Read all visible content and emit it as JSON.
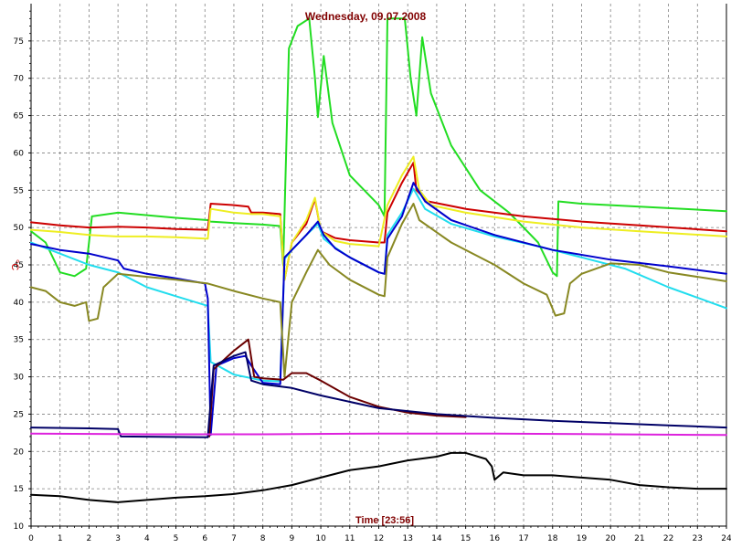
{
  "chart_data": {
    "type": "line",
    "title": "Wednesday, 09.07.2008",
    "xlabel": "Time [23:56]",
    "ylabel": "°C",
    "xlim": [
      0,
      24
    ],
    "ylim": [
      10,
      80
    ],
    "grid": true,
    "x_ticks": [
      "0",
      "1",
      "2",
      "3",
      "4",
      "5",
      "6",
      "7",
      "8",
      "9",
      "10",
      "11",
      "12",
      "13",
      "14",
      "15",
      "16",
      "17",
      "18",
      "19",
      "20",
      "21",
      "22",
      "23",
      "24"
    ],
    "y_ticks": [
      "10",
      "15",
      "20",
      "25",
      "30",
      "35",
      "40",
      "45",
      "50",
      "55",
      "60",
      "65",
      "70",
      "75"
    ],
    "series": [
      {
        "color": "#22dd22",
        "points": [
          [
            0,
            49.5
          ],
          [
            0.5,
            48
          ],
          [
            1,
            44
          ],
          [
            1.5,
            43.5
          ],
          [
            1.9,
            44.5
          ],
          [
            2.1,
            51.5
          ],
          [
            3,
            52
          ],
          [
            5,
            51.3
          ],
          [
            6.1,
            51
          ],
          [
            6.2,
            50.8
          ],
          [
            7,
            50.6
          ],
          [
            8,
            50.4
          ],
          [
            8.6,
            50.2
          ],
          [
            8.7,
            45
          ],
          [
            8.9,
            74
          ],
          [
            9.2,
            77
          ],
          [
            9.6,
            78
          ],
          [
            9.8,
            70
          ],
          [
            9.9,
            64.8
          ],
          [
            10.1,
            73
          ],
          [
            10.4,
            64
          ],
          [
            11,
            57
          ],
          [
            12,
            53
          ],
          [
            12.2,
            51.5
          ],
          [
            12.3,
            78
          ],
          [
            12.9,
            78
          ],
          [
            13.1,
            70
          ],
          [
            13.3,
            65
          ],
          [
            13.5,
            75.5
          ],
          [
            13.8,
            68
          ],
          [
            14.5,
            61
          ],
          [
            15.5,
            55
          ],
          [
            16.5,
            52
          ],
          [
            17.5,
            48
          ],
          [
            18,
            44
          ],
          [
            18.15,
            43.5
          ],
          [
            18.2,
            53.5
          ],
          [
            19,
            53.2
          ],
          [
            20,
            53
          ],
          [
            22,
            52.6
          ],
          [
            24,
            52.2
          ]
        ]
      },
      {
        "color": "#cc0000",
        "points": [
          [
            0,
            50.7
          ],
          [
            1,
            50.3
          ],
          [
            2,
            50
          ],
          [
            3,
            50.1
          ],
          [
            4,
            50
          ],
          [
            5,
            49.8
          ],
          [
            6.1,
            49.7
          ],
          [
            6.2,
            53.2
          ],
          [
            7,
            53
          ],
          [
            7.5,
            52.8
          ],
          [
            7.6,
            52
          ],
          [
            8,
            52
          ],
          [
            8.6,
            51.8
          ],
          [
            8.75,
            43
          ],
          [
            9,
            48
          ],
          [
            9.5,
            50.5
          ],
          [
            9.8,
            53.8
          ],
          [
            10,
            49.5
          ],
          [
            10.5,
            48.6
          ],
          [
            11,
            48.3
          ],
          [
            12,
            48
          ],
          [
            12.2,
            48
          ],
          [
            12.3,
            52
          ],
          [
            12.8,
            56
          ],
          [
            13.2,
            58.7
          ],
          [
            13.3,
            55
          ],
          [
            13.7,
            53.5
          ],
          [
            15,
            52.5
          ],
          [
            17,
            51.5
          ],
          [
            19,
            50.8
          ],
          [
            21,
            50.3
          ],
          [
            24,
            49.5
          ]
        ]
      },
      {
        "color": "#eeee22",
        "points": [
          [
            0,
            49.7
          ],
          [
            1,
            49.4
          ],
          [
            2,
            49
          ],
          [
            3,
            48.8
          ],
          [
            4,
            48.8
          ],
          [
            5,
            48.7
          ],
          [
            6.1,
            48.5
          ],
          [
            6.2,
            52.5
          ],
          [
            7,
            52
          ],
          [
            7.6,
            51.8
          ],
          [
            8,
            51.8
          ],
          [
            8.6,
            51.5
          ],
          [
            8.75,
            43
          ],
          [
            9,
            48
          ],
          [
            9.5,
            51
          ],
          [
            9.8,
            54
          ],
          [
            10,
            49.5
          ],
          [
            10.5,
            48.2
          ],
          [
            11,
            47.8
          ],
          [
            12,
            47.5
          ],
          [
            12.3,
            53
          ],
          [
            12.8,
            57
          ],
          [
            13.2,
            59.5
          ],
          [
            13.4,
            55
          ],
          [
            13.8,
            53
          ],
          [
            15,
            52
          ],
          [
            17,
            50.8
          ],
          [
            19,
            50
          ],
          [
            21,
            49.5
          ],
          [
            24,
            48.8
          ]
        ]
      },
      {
        "color": "#22ddee",
        "points": [
          [
            0,
            48
          ],
          [
            1,
            46.5
          ],
          [
            2,
            45
          ],
          [
            3,
            44
          ],
          [
            4,
            42
          ],
          [
            5,
            40.8
          ],
          [
            6.1,
            39.5
          ],
          [
            6.2,
            32
          ],
          [
            7,
            30.3
          ],
          [
            8,
            29.5
          ],
          [
            8.6,
            29.4
          ],
          [
            8.75,
            45.8
          ],
          [
            9,
            47
          ],
          [
            9.5,
            49
          ],
          [
            9.9,
            50.5
          ],
          [
            10.1,
            48.5
          ],
          [
            10.5,
            47.3
          ],
          [
            11,
            46
          ],
          [
            12,
            44
          ],
          [
            12.2,
            43.8
          ],
          [
            12.3,
            49
          ],
          [
            12.8,
            52
          ],
          [
            13.2,
            55.2
          ],
          [
            13.6,
            52.5
          ],
          [
            14.5,
            50.5
          ],
          [
            16,
            48.8
          ],
          [
            17.5,
            47.5
          ],
          [
            19,
            46
          ],
          [
            20.5,
            44.5
          ],
          [
            22,
            42
          ],
          [
            24,
            39.2
          ]
        ]
      },
      {
        "color": "#0000cc",
        "points": [
          [
            0,
            47.8
          ],
          [
            1,
            47
          ],
          [
            2,
            46.5
          ],
          [
            3,
            45.6
          ],
          [
            3.2,
            44.5
          ],
          [
            4,
            43.8
          ],
          [
            5,
            43.2
          ],
          [
            6,
            42.5
          ],
          [
            6.1,
            40.5
          ],
          [
            6.2,
            22.2
          ],
          [
            6.4,
            31.5
          ],
          [
            7,
            32.5
          ],
          [
            7.4,
            32.8
          ],
          [
            7.6,
            31.5
          ],
          [
            8,
            29.2
          ],
          [
            8.6,
            29
          ],
          [
            8.75,
            46
          ],
          [
            9,
            47
          ],
          [
            9.5,
            49
          ],
          [
            9.9,
            50.8
          ],
          [
            10.1,
            49
          ],
          [
            10.5,
            47.2
          ],
          [
            11,
            46
          ],
          [
            12,
            44
          ],
          [
            12.2,
            43.8
          ],
          [
            12.3,
            48.5
          ],
          [
            12.8,
            51.5
          ],
          [
            13.2,
            56
          ],
          [
            13.6,
            53.5
          ],
          [
            14.5,
            51
          ],
          [
            16,
            49
          ],
          [
            18,
            47
          ],
          [
            20,
            45.7
          ],
          [
            22,
            44.8
          ],
          [
            24,
            43.8
          ]
        ]
      },
      {
        "color": "#888822",
        "points": [
          [
            0,
            42
          ],
          [
            0.5,
            41.5
          ],
          [
            1,
            40
          ],
          [
            1.5,
            39.5
          ],
          [
            1.9,
            40
          ],
          [
            2,
            37.5
          ],
          [
            2.3,
            37.8
          ],
          [
            2.5,
            42
          ],
          [
            3,
            43.8
          ],
          [
            4,
            43.4
          ],
          [
            5,
            43
          ],
          [
            6.1,
            42.5
          ],
          [
            7,
            41.5
          ],
          [
            8,
            40.5
          ],
          [
            8.6,
            40
          ],
          [
            8.75,
            30
          ],
          [
            9,
            40
          ],
          [
            9.5,
            44
          ],
          [
            9.9,
            47
          ],
          [
            10.3,
            45
          ],
          [
            11,
            43
          ],
          [
            12,
            41
          ],
          [
            12.2,
            40.8
          ],
          [
            12.3,
            46
          ],
          [
            12.8,
            50.5
          ],
          [
            13.2,
            53.2
          ],
          [
            13.4,
            51
          ],
          [
            14.5,
            48
          ],
          [
            16,
            45
          ],
          [
            17,
            42.5
          ],
          [
            17.8,
            41
          ],
          [
            18.1,
            38.2
          ],
          [
            18.4,
            38.5
          ],
          [
            18.6,
            42.5
          ],
          [
            19,
            43.8
          ],
          [
            20,
            45.2
          ],
          [
            21,
            45
          ],
          [
            22,
            44
          ],
          [
            24,
            42.8
          ]
        ]
      },
      {
        "color": "#6b0000",
        "points": [
          [
            6.15,
            22
          ],
          [
            6.3,
            31
          ],
          [
            7,
            33.5
          ],
          [
            7.5,
            35
          ],
          [
            7.7,
            30
          ],
          [
            8,
            29.8
          ],
          [
            8.7,
            29.6
          ],
          [
            9,
            30.5
          ],
          [
            9.5,
            30.5
          ],
          [
            10,
            29.5
          ],
          [
            11,
            27.3
          ],
          [
            12,
            26
          ],
          [
            13,
            25.2
          ],
          [
            14,
            24.8
          ],
          [
            15,
            24.6
          ]
        ]
      },
      {
        "color": "#000066",
        "points": [
          [
            0,
            23.2
          ],
          [
            2,
            23.1
          ],
          [
            3,
            23
          ],
          [
            3.1,
            22
          ],
          [
            6.1,
            21.9
          ],
          [
            6.3,
            31.5
          ],
          [
            7,
            32.8
          ],
          [
            7.4,
            33.3
          ],
          [
            7.6,
            29.5
          ],
          [
            8,
            29
          ],
          [
            9,
            28.5
          ],
          [
            10,
            27.5
          ],
          [
            12,
            25.8
          ],
          [
            14,
            25
          ],
          [
            16,
            24.5
          ],
          [
            18,
            24.1
          ],
          [
            20,
            23.8
          ],
          [
            22,
            23.5
          ],
          [
            24,
            23.2
          ]
        ]
      },
      {
        "color": "#dd22dd",
        "points": [
          [
            0,
            22.4
          ],
          [
            4,
            22.3
          ],
          [
            8,
            22.3
          ],
          [
            12,
            22.4
          ],
          [
            16,
            22.4
          ],
          [
            20,
            22.3
          ],
          [
            24,
            22.2
          ]
        ]
      },
      {
        "color": "#000000",
        "points": [
          [
            0,
            14.2
          ],
          [
            1,
            14
          ],
          [
            2,
            13.5
          ],
          [
            3,
            13.2
          ],
          [
            4,
            13.5
          ],
          [
            5,
            13.8
          ],
          [
            6,
            14
          ],
          [
            7,
            14.3
          ],
          [
            8,
            14.8
          ],
          [
            9,
            15.5
          ],
          [
            10,
            16.5
          ],
          [
            11,
            17.5
          ],
          [
            12,
            18
          ],
          [
            13,
            18.8
          ],
          [
            14,
            19.3
          ],
          [
            14.5,
            19.8
          ],
          [
            15,
            19.8
          ],
          [
            15.7,
            19
          ],
          [
            15.9,
            18
          ],
          [
            16,
            16.2
          ],
          [
            16.3,
            17.2
          ],
          [
            17,
            16.8
          ],
          [
            18,
            16.8
          ],
          [
            19,
            16.5
          ],
          [
            20,
            16.2
          ],
          [
            21,
            15.5
          ],
          [
            22,
            15.2
          ],
          [
            23,
            15
          ],
          [
            24,
            15
          ]
        ]
      }
    ]
  }
}
